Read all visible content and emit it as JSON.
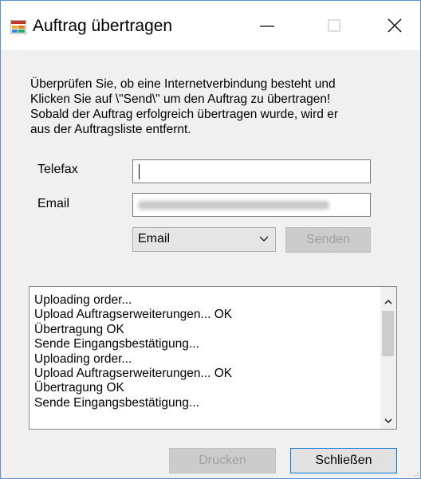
{
  "window": {
    "title": "Auftrag übertragen",
    "icon": "app-window-icon",
    "controls": {
      "minimize": "—",
      "maximize": "☐",
      "close": "✕"
    }
  },
  "form": {
    "instructions": [
      "Überprüfen Sie, ob eine Internetverbindung besteht und",
      "Klicken Sie auf \\\"Send\\\" um den Auftrag zu übertragen!",
      "Sobald der Auftrag erfolgreich übertragen wurde, wird er",
      "aus der Auftragsliste entfernt."
    ],
    "telefax": {
      "label": "Telefax",
      "value": ""
    },
    "email": {
      "label": "Email",
      "value_state": "blurred"
    },
    "method_select": {
      "value": "Email"
    },
    "send_button": {
      "label": "Senden",
      "enabled": false
    }
  },
  "log": {
    "lines": [
      "Uploading order...",
      "Upload Auftragserweiterungen... OK",
      "Übertragung OK",
      "Sende Eingangsbestätigung...",
      "Uploading order...",
      "Upload Auftragserweiterungen... OK",
      "Übertragung OK",
      "Sende Eingangsbestätigung..."
    ]
  },
  "footer": {
    "print_button": {
      "label": "Drucken",
      "enabled": false
    },
    "close_button": {
      "label": "Schließen"
    }
  }
}
